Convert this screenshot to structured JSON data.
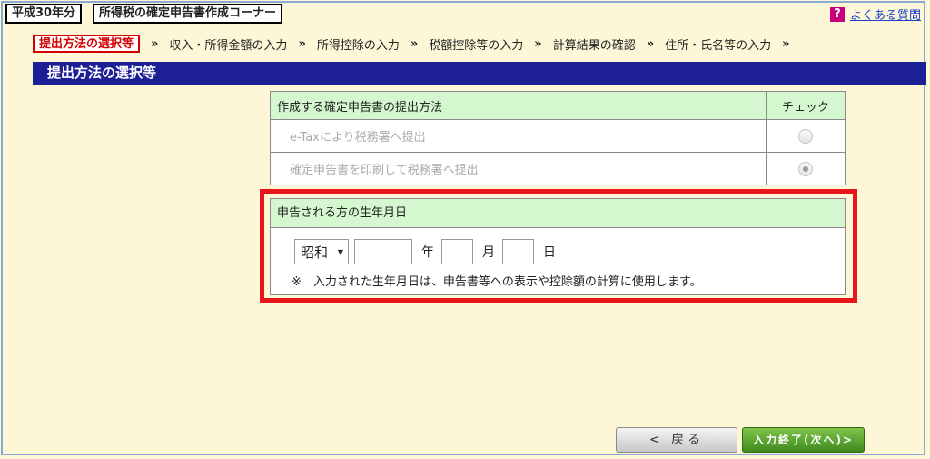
{
  "header": {
    "year_label": "平成30年分",
    "corner_title": "所得税の確定申告書作成コーナー",
    "faq_icon": "?",
    "faq_link": "よくある質問"
  },
  "steps": [
    {
      "label": "提出方法の選択等",
      "active": true
    },
    {
      "label": "収入・所得金額の入力"
    },
    {
      "label": "所得控除の入力"
    },
    {
      "label": "税額控除等の入力"
    },
    {
      "label": "計算結果の確認"
    },
    {
      "label": "住所・氏名等の入力"
    }
  ],
  "step_separator": "»",
  "section_title": "提出方法の選択等",
  "method_table": {
    "header_method": "作成する確定申告書の提出方法",
    "header_check": "チェック",
    "options": [
      {
        "label": "e-Taxにより税務署へ提出",
        "checked": false
      },
      {
        "label": "確定申告書を印刷して税務署へ提出",
        "checked": true
      }
    ]
  },
  "birth": {
    "header": "申告される方の生年月日",
    "era_selected": "昭和",
    "year_value": "",
    "month_value": "",
    "day_value": "",
    "year_unit": "年",
    "month_unit": "月",
    "day_unit": "日",
    "note": "※　入力された生年月日は、申告書等への表示や控除額の計算に使用します。"
  },
  "buttons": {
    "back": "< 戻る",
    "next": "入力終了(次へ)>"
  }
}
